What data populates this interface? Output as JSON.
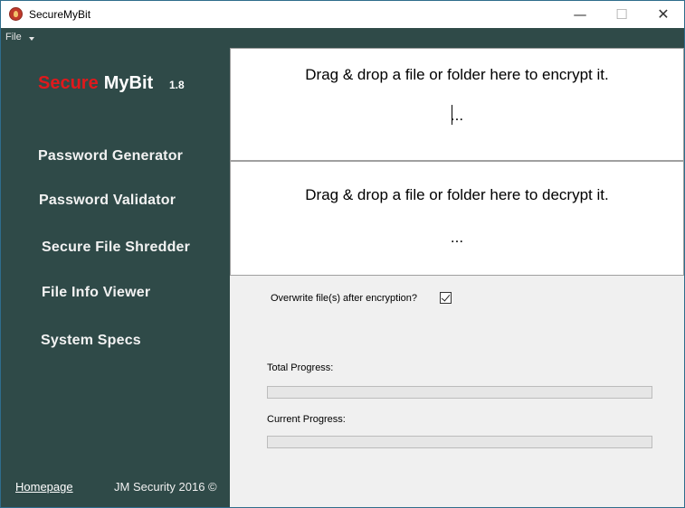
{
  "window": {
    "title": "SecureMyBit",
    "minimize_glyph": "—",
    "maximize_glyph": "☐",
    "close_glyph": "✕"
  },
  "menu": {
    "file_label": "File"
  },
  "sidebar": {
    "brand_secure": "Secure",
    "brand_mybit": "MyBit",
    "version": "1.8",
    "items": [
      {
        "label": "Password Generator"
      },
      {
        "label": "Password Validator"
      },
      {
        "label": "Secure File Shredder"
      },
      {
        "label": "File Info Viewer"
      },
      {
        "label": "System Specs"
      }
    ],
    "homepage_label": "Homepage",
    "copyright": "JM Security 2016 ©"
  },
  "encrypt_zone": {
    "prompt": "Drag & drop a file or folder here to encrypt it.",
    "status": "..."
  },
  "decrypt_zone": {
    "prompt": "Drag & drop a file or folder here to decrypt it.",
    "status": "..."
  },
  "options": {
    "overwrite_label": "Overwrite file(s) after encryption?",
    "overwrite_checked": true
  },
  "progress": {
    "total_label": "Total Progress:",
    "total_value": 0,
    "current_label": "Current Progress:",
    "current_value": 0
  },
  "colors": {
    "sidebar_bg": "#2f4a48",
    "brand_red": "#e0191c",
    "content_bg": "#f0f0f0",
    "progress_fill": "#06b025"
  }
}
